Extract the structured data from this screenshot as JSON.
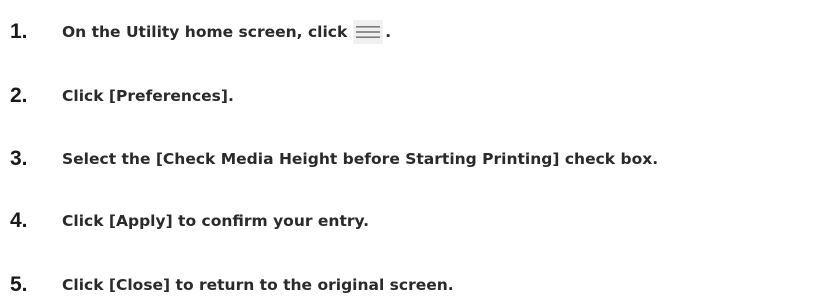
{
  "steps": [
    {
      "number": "1.",
      "text_before": "On the Utility home screen, click",
      "icon": "hamburger-menu-icon",
      "text_after": "."
    },
    {
      "number": "2.",
      "text": "Click [Preferences]."
    },
    {
      "number": "3.",
      "text": "Select the [Check Media Height before Starting Printing] check box."
    },
    {
      "number": "4.",
      "text": "Click [Apply] to confirm your entry."
    },
    {
      "number": "5.",
      "text": "Click [Close] to return to the original screen."
    }
  ]
}
